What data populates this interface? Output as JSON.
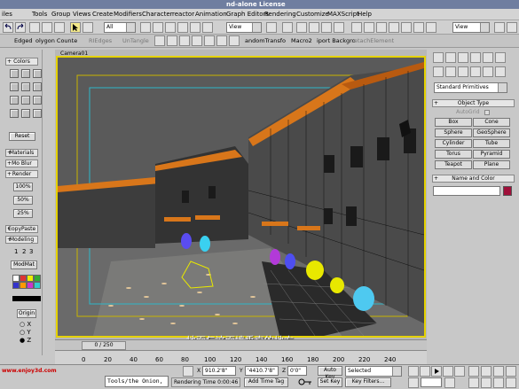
{
  "title": {
    "text": "nd-alone License"
  },
  "menu": [
    "iles",
    "Tools",
    "Group",
    "Views",
    "Create",
    "Modifiers",
    "Character",
    "reactor",
    "Animation",
    "Graph Editors",
    "Rendering",
    "Customize",
    "MAXScript",
    "Help"
  ],
  "toolbar": {
    "selection_filter": "All",
    "ref_coord": "View",
    "ref_coord2": "View"
  },
  "tabs": [
    "Edged",
    "olygon Counte",
    "RIEdges",
    "UnTangle",
    "andomTransfo",
    "Macro2",
    "iport Backgro",
    "etachElement"
  ],
  "left": {
    "colors": "Colors",
    "reset": "Reset",
    "materials": "Materials",
    "moblur": "Mo Blur",
    "render": "Render",
    "r100": "100%",
    "r50": "50%",
    "r25": "25%",
    "copypaste": "CopyPaste",
    "modeling": "Modeling",
    "n1": "1",
    "n2": "2",
    "n3": "3",
    "modmat": "ModMat",
    "origin": "Origin",
    "ax": "X",
    "ay": "Y",
    "az": "Z"
  },
  "viewport": {
    "label": "Camera01",
    "subtitle": "地面与这面墙垂直的地方"
  },
  "right": {
    "dropdown": "Standard Primitives",
    "object_type": "Object Type",
    "autogrid": "AutoGrid",
    "buttons": [
      "Box",
      "Cone",
      "Sphere",
      "GeoSphere",
      "Cylinder",
      "Tube",
      "Torus",
      "Pyramid",
      "Teapot",
      "Plane"
    ],
    "name_color": "Name and Color"
  },
  "timeline": {
    "frame": "0 / 250",
    "ticks": [
      "0",
      "20",
      "40",
      "60",
      "80",
      "100",
      "120",
      "140",
      "160",
      "180",
      "200",
      "220",
      "240"
    ]
  },
  "status": {
    "x_value": "910.2'8\"",
    "y_value": "'4410.7'8\"",
    "z_value": "0'0\"",
    "x_label": "X",
    "y_label": "Y",
    "z_label": "Z",
    "auto_key": "Auto Key",
    "selected": "Selected",
    "set_key": "Set Key",
    "key_filters": "Key Filters...",
    "rendering_time": "Rendering Time  0:00:46",
    "add_time_tag": "Add Time Tag",
    "watermark": "www.enjoy3d.com",
    "tools_text": "Tools/the Onion,"
  },
  "colors": {
    "selection_color": "#a0103a",
    "frame_yellow": "#e5d200"
  }
}
